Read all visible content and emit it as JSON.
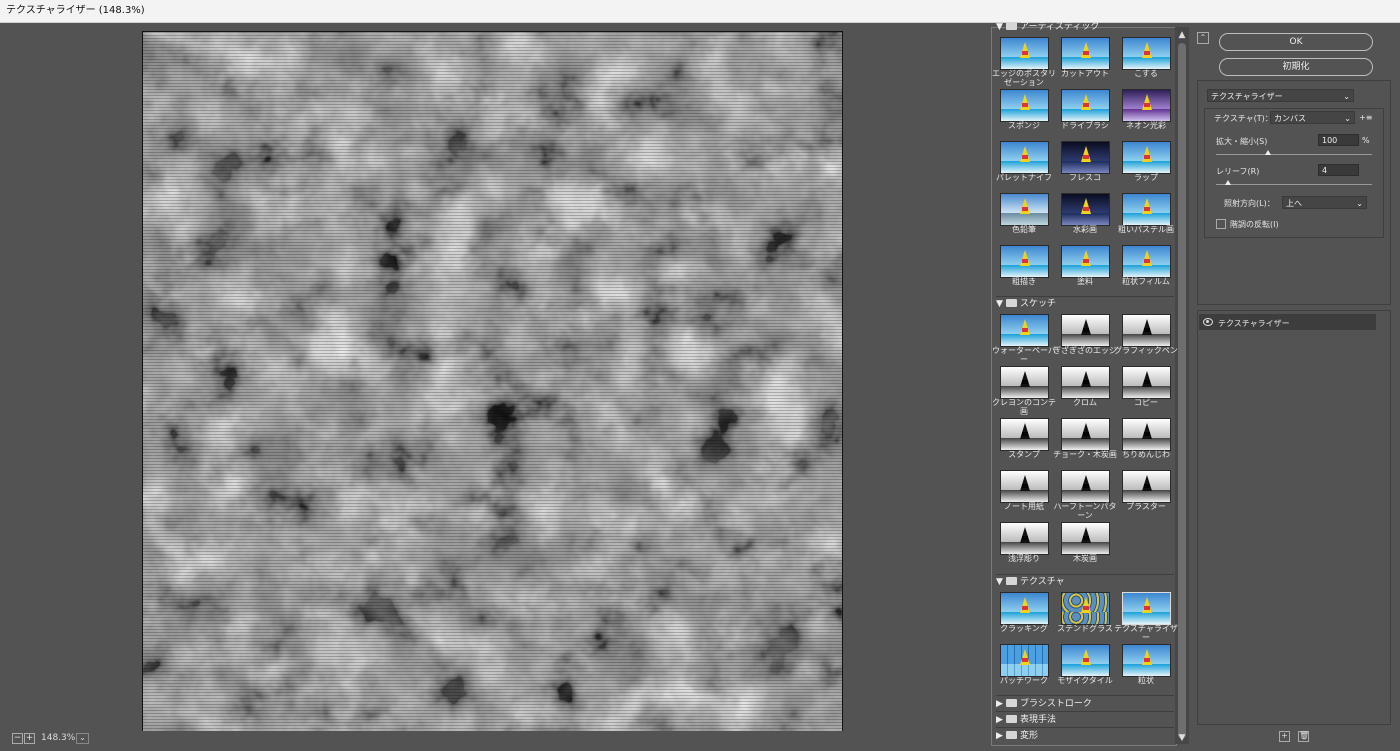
{
  "window": {
    "title": "テクスチャライザー (148.3%)"
  },
  "status": {
    "zoom": "148.3%",
    "zoom_out": "−",
    "zoom_in": "+",
    "dropdown": "⌄"
  },
  "gallery": {
    "top_category_name": "アーティスティック",
    "rows_artistic": [
      {
        "label": "エッジのポスタリゼーション",
        "style": "color"
      },
      {
        "label": "カットアウト",
        "style": "color"
      },
      {
        "label": "こする",
        "style": "color"
      },
      {
        "label": "スポンジ",
        "style": "color"
      },
      {
        "label": "ドライブラシ",
        "style": "color"
      },
      {
        "label": "ネオン光彩",
        "style": "neon"
      },
      {
        "label": "パレットナイフ",
        "style": "color"
      },
      {
        "label": "フレスコ",
        "style": "dark"
      },
      {
        "label": "ラップ",
        "style": "color"
      },
      {
        "label": "色鉛筆",
        "style": "mtn"
      },
      {
        "label": "水彩画",
        "style": "dark"
      },
      {
        "label": "粗いパステル画",
        "style": "color"
      },
      {
        "label": "粗描き",
        "style": "color"
      },
      {
        "label": "塗料",
        "style": "color"
      },
      {
        "label": "粒状フィルム",
        "style": "color"
      }
    ],
    "sketch": {
      "name": "スケッチ",
      "items": [
        {
          "label": "ウォーターペーパー",
          "style": "color"
        },
        {
          "label": "ぎざぎざのエッジ",
          "style": "bw"
        },
        {
          "label": "グラフィックペン",
          "style": "bw"
        },
        {
          "label": "クレヨンのコンテ画",
          "style": "bw"
        },
        {
          "label": "クロム",
          "style": "bw"
        },
        {
          "label": "コピー",
          "style": "bw"
        },
        {
          "label": "スタンプ",
          "style": "bw"
        },
        {
          "label": "チョーク・木炭画",
          "style": "bw"
        },
        {
          "label": "ちりめんじわ",
          "style": "bw"
        },
        {
          "label": "ノート用紙",
          "style": "bw"
        },
        {
          "label": "ハーフトーンパターン",
          "style": "bw"
        },
        {
          "label": "プラスター",
          "style": "bw"
        },
        {
          "label": "浅浮彫り",
          "style": "bw"
        },
        {
          "label": "木炭画",
          "style": "bw"
        }
      ]
    },
    "texture": {
      "name": "テクスチャ",
      "items": [
        {
          "label": "クラッキング",
          "style": "color"
        },
        {
          "label": "ステンドグラス",
          "style": "stained"
        },
        {
          "label": "テクスチャライザー",
          "style": "color",
          "selected": true
        },
        {
          "label": "パッチワーク",
          "style": "patch"
        },
        {
          "label": "モザイクタイル",
          "style": "color"
        },
        {
          "label": "粒状",
          "style": "color"
        }
      ]
    },
    "collapsed": [
      {
        "name": "ブラシストローク"
      },
      {
        "name": "表現手法"
      },
      {
        "name": "変形"
      }
    ]
  },
  "panel": {
    "ok": "OK",
    "reset": "初期化",
    "filter_select": "テクスチャライザー",
    "texture_label": "テクスチャ(T)：",
    "texture_value": "カンバス",
    "menu_icon": "+≡",
    "scale_label": "拡大・縮小(S)",
    "scale_value": "100",
    "scale_unit": "%",
    "scale_level": 100,
    "relief_label": "レリーフ(R)",
    "relief_value": "4",
    "light_label": "照射方向(L)：",
    "light_value": "上へ",
    "invert_label": "階調の反転(I)",
    "invert_checked": false
  },
  "layers": {
    "items": [
      {
        "label": "テクスチャライザー",
        "visible": true
      }
    ],
    "new_icon": "+",
    "delete_icon": "🗑"
  }
}
